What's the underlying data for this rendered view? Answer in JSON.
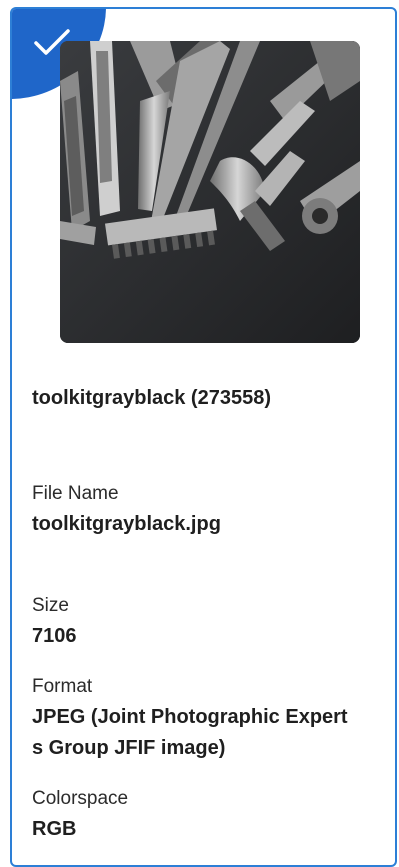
{
  "item": {
    "title": "toolkitgrayblack (273558)",
    "selected": true
  },
  "fields": {
    "file_name_label": "File Name",
    "file_name_value": "toolkitgrayblack.jpg",
    "size_label": "Size",
    "size_value": "7106",
    "format_label": "Format",
    "format_value_line1": "JPEG (Joint Photographic Expert",
    "format_value_line2": "s Group JFIF image)",
    "colorspace_label": "Colorspace",
    "colorspace_value": "RGB"
  },
  "icons": {
    "selected": "checkmark-icon"
  },
  "colors": {
    "accent": "#1f66c9",
    "border": "#2d7fd6"
  }
}
